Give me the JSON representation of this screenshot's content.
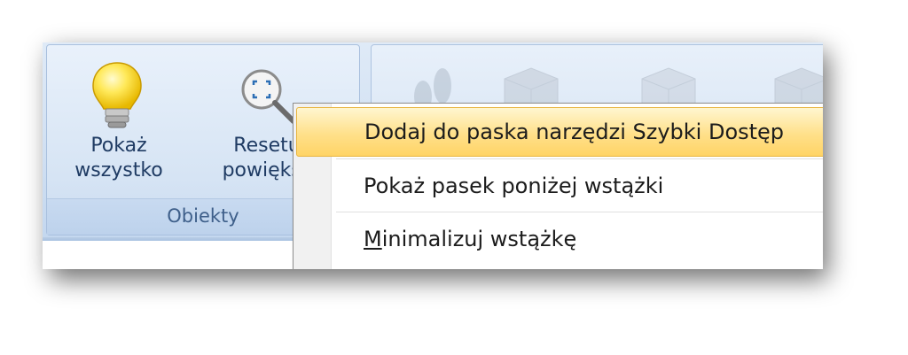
{
  "ribbon": {
    "group_objects": {
      "caption": "Obiekty",
      "buttons": [
        {
          "line1": "Pokaż",
          "line2": "wszystko",
          "icon": "lightbulb-icon"
        },
        {
          "line1": "Resetu",
          "line2": "powiększ",
          "icon": "zoom-reset-icon"
        }
      ]
    },
    "faded_icons": [
      "footprints-icon",
      "cube-icon",
      "cube-icon",
      "cube-icon"
    ]
  },
  "context_menu": {
    "items": [
      {
        "before": "Doda",
        "accel": "j",
        "after": " do paska narzędzi Szybki Dostęp",
        "highlighted": true
      },
      {
        "before": "Pokaż pasek poniżej wstążki",
        "accel": "",
        "after": "",
        "highlighted": false
      },
      {
        "before": "",
        "accel": "M",
        "after": "inimalizuj wstążkę",
        "highlighted": false
      }
    ]
  },
  "colors": {
    "ribbon_text": "#1f3b63",
    "caption_text": "#3e5f8a",
    "highlight_top": "#fff6d0",
    "highlight_bottom": "#ffd466",
    "highlight_border": "#e8b53f"
  }
}
